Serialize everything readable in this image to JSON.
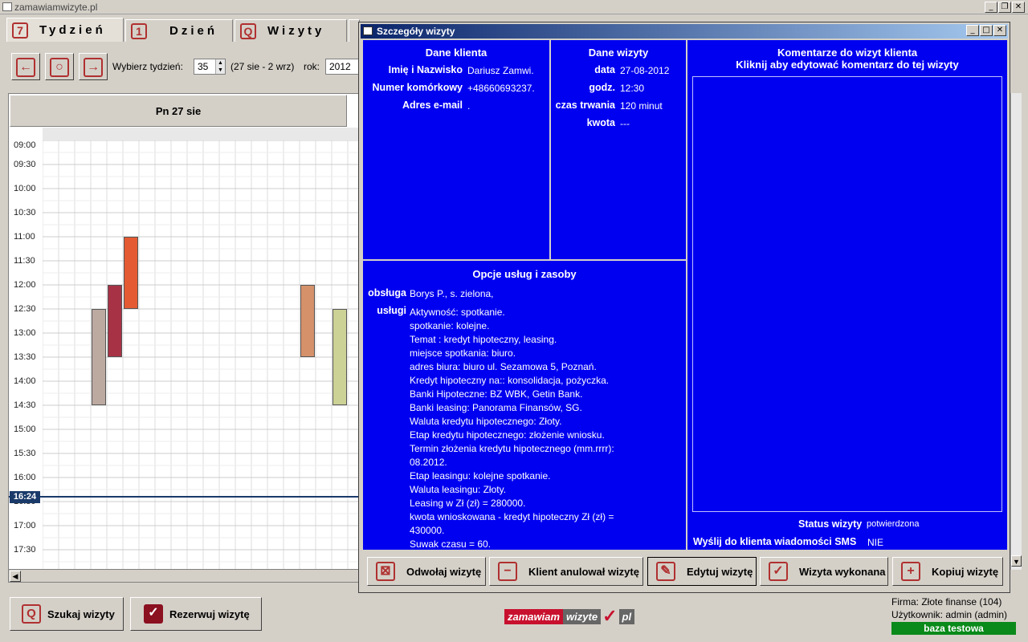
{
  "window": {
    "title": "zamawiamwizyte.pl"
  },
  "tabs": [
    {
      "label": "Tydzień",
      "icon": "7"
    },
    {
      "label": "Dzień",
      "icon": "1"
    },
    {
      "label": "Wizyty",
      "icon": "Q"
    }
  ],
  "toolbar": {
    "week_label": "Wybierz tydzień:",
    "week_value": "35",
    "range": "(27 sie - 2 wrz)",
    "year_label": "rok:",
    "year_value": "2012"
  },
  "calendar": {
    "day_header": "Pn 27 sie",
    "times": [
      "09:00",
      "09:30",
      "10:00",
      "10:30",
      "11:00",
      "11:30",
      "12:00",
      "12:30",
      "13:00",
      "13:30",
      "14:00",
      "14:30",
      "15:00",
      "15:30",
      "16:00",
      "16:30",
      "17:00",
      "17:30"
    ],
    "now": "16:24",
    "events": [
      {
        "color": "#bca9a0",
        "start": "12:30",
        "end": "14:30",
        "col": 3
      },
      {
        "color": "#a83245",
        "start": "12:00",
        "end": "13:30",
        "col": 4
      },
      {
        "color": "#e45a32",
        "start": "11:00",
        "end": "12:30",
        "col": 5
      },
      {
        "color": "#d4916a",
        "start": "12:00",
        "end": "13:30",
        "col": 16
      },
      {
        "color": "#ccd196",
        "start": "12:30",
        "end": "14:30",
        "col": 18
      }
    ]
  },
  "dialog": {
    "title": "Szczegóły wizyty",
    "client": {
      "heading": "Dane klienta",
      "name_label": "Imię i Nazwisko",
      "name": "Dariusz Zamwi.",
      "phone_label": "Numer komórkowy",
      "phone": "+48660693237.",
      "email_label": "Adres e-mail",
      "email": "."
    },
    "visit": {
      "heading": "Dane wizyty",
      "date_label": "data",
      "date": "27-08-2012",
      "time_label": "godz.",
      "time": "12:30",
      "duration_label": "czas trwania",
      "duration": "120 minut",
      "amount_label": "kwota",
      "amount": "---"
    },
    "comments": {
      "heading1": "Komentarze do wizyt klienta",
      "heading2": "Kliknij aby edytować komentarz do tej wizyty",
      "status_label": "Status wizyty",
      "status": "potwierdzona",
      "sms_label": "Wyślij do klienta wiadomości SMS",
      "sms": "NIE"
    },
    "services": {
      "heading": "Opcje usług i zasoby",
      "staff_label": "obsługa",
      "staff": "Borys P., s. zielona,",
      "services_label": "usługi",
      "lines": [
        "Aktywność: spotkanie.",
        "spotkanie: kolejne.",
        "Temat : kredyt hipoteczny, leasing.",
        "miejsce spotkania: biuro.",
        "adres biura: biuro ul. Sezamowa 5, Poznań.",
        "Kredyt hipoteczny na:: konsolidacja, pożyczka.",
        "Banki Hipoteczne: BZ WBK, Getin Bank.",
        "Banki leasing: Panorama Finansów, SG.",
        "Waluta kredytu hipotecznego: Złoty.",
        "Etap kredytu hipotecznego: złożenie wniosku.",
        "Termin złożenia kredytu hipotecznego (mm.rrrr):",
        "08.2012.",
        "Etap leasingu: kolejne spotkanie.",
        "Waluta leasingu: Złoty.",
        "Leasing w Zł (zł) = 280000.",
        "kwota wnioskowana - kredyt hipoteczny Zł (zł) =",
        "430000.",
        "Suwak czasu = 60."
      ]
    },
    "buttons": {
      "cancel_visit": "Odwołaj wizytę",
      "client_cancelled": "Klient anulował wizytę",
      "edit": "Edytuj wizytę",
      "done": "Wizyta wykonana",
      "copy": "Kopiuj wizytę"
    }
  },
  "bottom": {
    "search": "Szukaj wizyty",
    "book": "Rezerwuj wizytę",
    "logo_text": "zamawiam",
    "logo_text2": "wizyte",
    "logo_text3": "pl",
    "company": "Firma: Złote finanse (104)",
    "user": "Użytkownik: admin (admin)",
    "db": "baza testowa"
  }
}
